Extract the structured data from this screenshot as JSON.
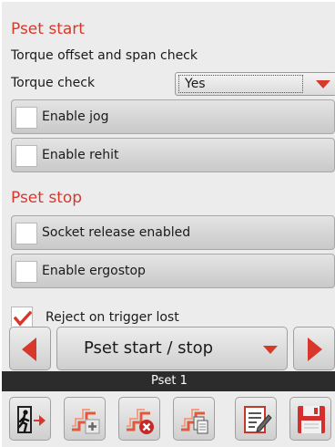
{
  "pset_start": {
    "title": "Pset start",
    "subtitle": "Torque offset and span check",
    "torque_check_label": "Torque check",
    "torque_check_value": "Yes",
    "enable_jog": {
      "label": "Enable jog",
      "checked": false
    },
    "enable_rehit": {
      "label": "Enable rehit",
      "checked": false
    }
  },
  "pset_stop": {
    "title": "Pset stop",
    "socket_release": {
      "label": "Socket release enabled",
      "checked": false
    },
    "enable_ergostop": {
      "label": "Enable ergostop",
      "checked": false
    },
    "reject_on_trigger_lost": {
      "label": "Reject on trigger lost",
      "checked": true
    }
  },
  "navigation": {
    "current_page": "Pset start / stop",
    "prev_icon": "arrow-left-icon",
    "next_icon": "arrow-right-icon"
  },
  "status": {
    "text": "Pset 1"
  },
  "toolbar": {
    "buttons": [
      {
        "icon": "exit-icon"
      },
      {
        "icon": "add-step-icon"
      },
      {
        "icon": "delete-step-icon"
      },
      {
        "icon": "copy-step-icon"
      },
      {
        "icon": "edit-notes-icon"
      },
      {
        "icon": "save-icon"
      }
    ]
  },
  "colors": {
    "accent": "#d8372b",
    "status_bar": "#2c2c2c",
    "background": "#ececec"
  }
}
